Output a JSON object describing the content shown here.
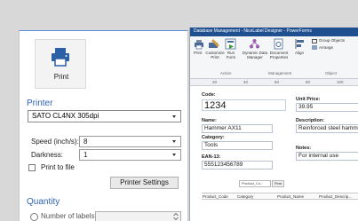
{
  "print_panel": {
    "print_button_label": "Print",
    "printer_section_title": "Printer",
    "printer_selected": "SATO CL4NX 305dpi",
    "speed_label": "Speed (inch/s):",
    "speed_value": "8",
    "darkness_label": "Darkness:",
    "darkness_value": "1",
    "print_to_file_label": "Print to file",
    "print_to_file_checked": false,
    "printer_settings_button": "Printer Settings",
    "quantity_section_title": "Quantity",
    "number_of_labels_label": "Number of labels",
    "number_of_labels_value": "",
    "accent_color": "#2e64b0"
  },
  "designer": {
    "title": "Database Management - NiceLabel Designer - PowerForms",
    "ribbon": {
      "buttons": [
        {
          "label": "Print",
          "icon": "print-icon"
        },
        {
          "label": "Customize Print",
          "icon": "customize-print-icon"
        },
        {
          "label": "Run Form",
          "icon": "run-form-icon"
        },
        {
          "label": "Dynamic Data Manager",
          "icon": "dynamic-data-manager-icon"
        },
        {
          "label": "Document Properties",
          "icon": "document-properties-icon"
        },
        {
          "label": "Align",
          "icon": "align-icon"
        }
      ],
      "group_object_label": "Group Objects",
      "arrange_label": "Arrange",
      "groups": {
        "action": "Action",
        "management": "Management",
        "object": "Object"
      }
    },
    "ruler_numbers": [
      "20",
      "40",
      "60",
      "80",
      "100"
    ],
    "form": {
      "code_label": "Code:",
      "code_value": "1234",
      "unit_price_label": "Unit Price:",
      "unit_price_value": "39.95",
      "name_label": "Name:",
      "name_value": "Hammer AX11",
      "description_label": "Description:",
      "description_value": "Reinforced steel hammer",
      "category_label": "Category:",
      "category_value": "Tools",
      "notes_label": "Notes:",
      "notes_value": "For internal use",
      "ean_label": "EAN-13:",
      "ean_value": "555123456789",
      "filter_text": "Product_Co...",
      "find_button": "Find",
      "columns": [
        "Product_Code",
        "Category",
        "Product_Name",
        "Product_Descrip..."
      ]
    },
    "titlebar_color": "#1f4f8f"
  }
}
